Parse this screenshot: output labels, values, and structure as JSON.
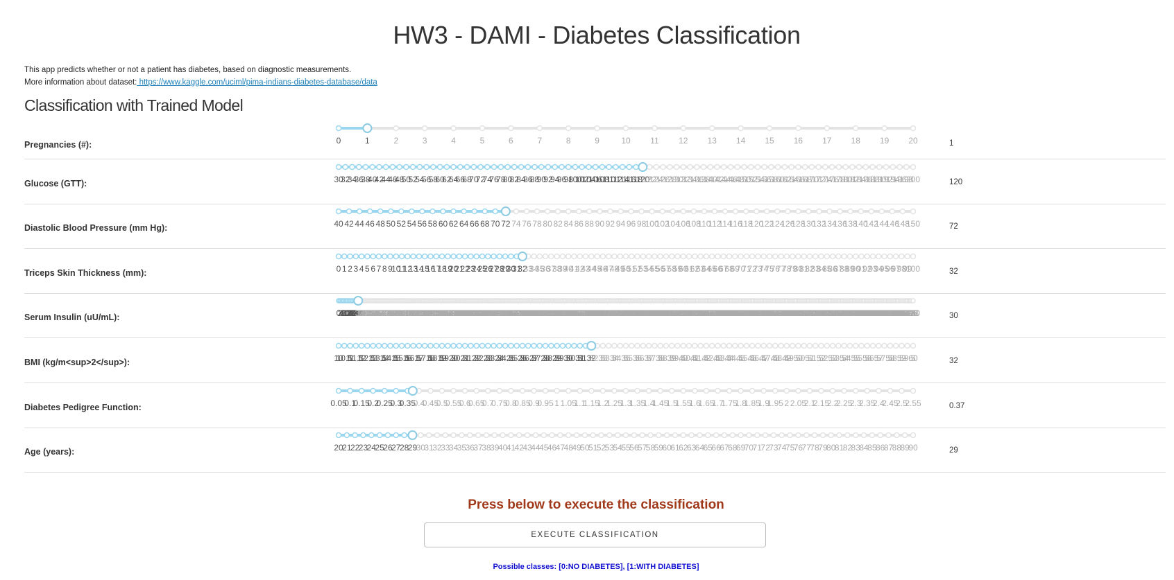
{
  "header": {
    "title": "HW3 - DAMI - Diabetes Classification"
  },
  "intro": {
    "line1": "This app predicts whether or not a patient has diabetes, based on diagnostic measurements.",
    "line2_prefix": "More information about dataset:",
    "link_text": " https://www.kaggle.com/uciml/pima-indians-diabetes-database/data"
  },
  "section": {
    "title": "Classification with Trained Model"
  },
  "colors": {
    "active": "#9ad6ee",
    "handle_border": "#8ccbe3",
    "inactive": "#e3e3e3",
    "tick_active": "#555555",
    "tick_inactive": "#aaaaaa"
  },
  "sliders": [
    {
      "label": "Pregnancies (#):",
      "value": "1",
      "min": 0,
      "max": 20,
      "step": 1,
      "current": 1,
      "decimals": 0
    },
    {
      "label": "Glucose (GTT):",
      "value": "120",
      "min": 30,
      "max": 200,
      "step": 2,
      "current": 120,
      "decimals": 0
    },
    {
      "label": "Diastolic Blood Pressure (mm Hg):",
      "value": "72",
      "min": 40,
      "max": 150,
      "step": 2,
      "current": 72,
      "decimals": 0
    },
    {
      "label": "Triceps Skin Thickness (mm):",
      "value": "32",
      "min": 0,
      "max": 100,
      "step": 1,
      "current": 32,
      "decimals": 0
    },
    {
      "label": "Serum Insulin (uU/mL):",
      "value": "30",
      "min": 0,
      "max": 880,
      "step": 2,
      "current": 30,
      "decimals": 0
    },
    {
      "label": "BMI (kg/m<sup>2</sup>):",
      "value": "32",
      "min": 10,
      "max": 60,
      "step": 0.5,
      "current": 32,
      "decimals": 1
    },
    {
      "label": "Diabetes Pedigree Function:",
      "value": "0.37",
      "min": 0.05,
      "max": 2.53,
      "step": 0.05,
      "current": 0.37,
      "decimals": 2
    },
    {
      "label": "Age (years):",
      "value": "29",
      "min": 20,
      "max": 90,
      "step": 1,
      "current": 29,
      "decimals": 0
    }
  ],
  "cta": {
    "text": "Press below to execute the classification",
    "button_label": "EXECUTE CLASSIFICATION"
  },
  "footer": {
    "classes_text": "Possible classes: [0:NO DIABETES], [1:WITH DIABETES]"
  }
}
